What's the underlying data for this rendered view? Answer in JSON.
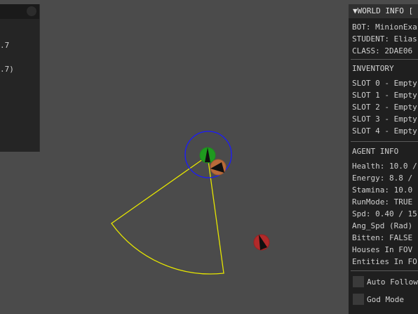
{
  "left_panel": {
    "values": [
      ".7",
      ".7)"
    ]
  },
  "world_info": {
    "title": "▼WORLD INFO [",
    "bot": "BOT: MinionExa",
    "student": "STUDENT: Elias",
    "class": "CLASS: 2DAE06",
    "inventory_header": "INVENTORY",
    "slots": [
      "SLOT 0 - Empty",
      "SLOT 1 - Empty",
      "SLOT 2 - Empty",
      "SLOT 3 - Empty",
      "SLOT 4 - Empty"
    ],
    "agent_header": "AGENT INFO",
    "health": "Health: 10.0 /",
    "energy": "Energy: 8.8 /",
    "stamina": "Stamina: 10.0",
    "runmode": "RunMode: TRUE",
    "spd": "Spd: 0.40 / 15",
    "ang_spd": "Ang_Spd (Rad)",
    "bitten": "Bitten: FALSE",
    "houses_fov": "Houses In FOV",
    "entities_fov": "Entities In FO",
    "auto_follow": "Auto Follow",
    "god_mode": "God Mode"
  },
  "colors": {
    "background": "#4b4b4b",
    "fov_cone": "#e6e600",
    "agent_circle": "#1a1aff",
    "agent_body": "#1f9a1f",
    "enemy_near": "#b86a3a",
    "enemy_far": "#b22a2a"
  }
}
